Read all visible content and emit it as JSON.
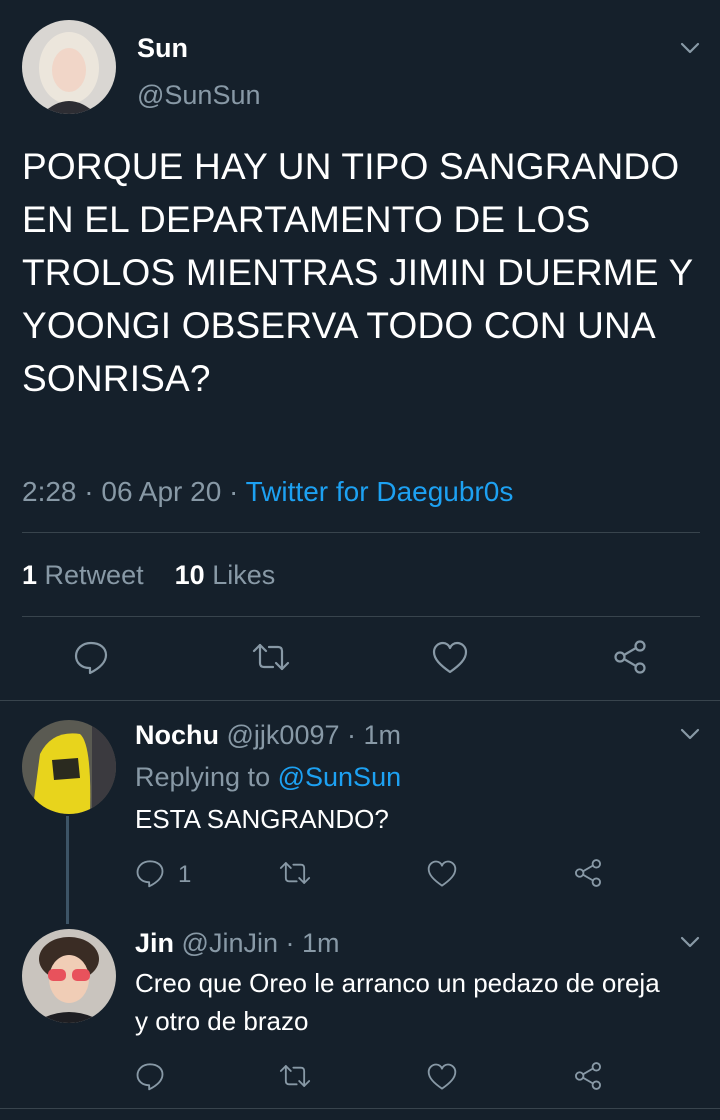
{
  "main_tweet": {
    "display_name": "Sun",
    "handle": "@SunSun",
    "text": "PORQUE HAY UN TIPO SANGRANDO EN EL DEPARTAMENTO DE LOS TROLOS MIENTRAS JIMIN DUERME Y YOONGI OBSERVA TODO CON UNA SONRISA?",
    "time": "2:28",
    "date": "06 Apr 20",
    "separator": "·",
    "source": "Twitter for Daegubr0s",
    "retweet_count": "1",
    "retweet_label": "Retweet",
    "like_count": "10",
    "like_label": "Likes"
  },
  "replies": [
    {
      "display_name": "Nochu",
      "handle": "@jjk0097",
      "time": "· 1m",
      "replying_prefix": "Replying to",
      "replying_to": "@SunSun",
      "text": "ESTA SANGRANDO?",
      "reply_count": "1"
    },
    {
      "display_name": "Jin",
      "handle": "@JinJin",
      "time": "· 1m",
      "text": "Creo que Oreo le arranco un pedazo de oreja y otro de brazo"
    }
  ],
  "colors": {
    "background": "#15202b",
    "muted": "#8899a6",
    "accent": "#1da1f2",
    "divider": "#38444d"
  }
}
